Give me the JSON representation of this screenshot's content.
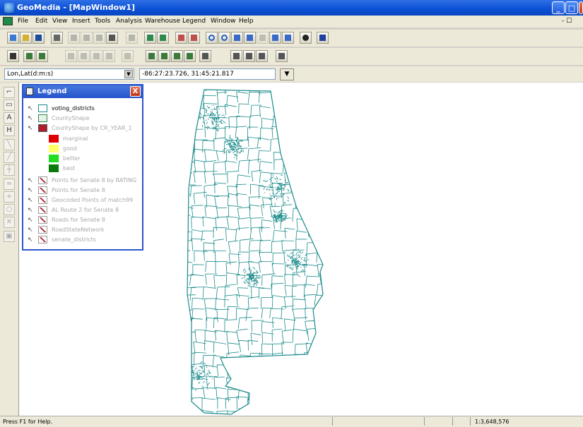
{
  "window": {
    "title": "GeoMedia - [MapWindow1]",
    "controls": [
      "_",
      "□",
      "X"
    ]
  },
  "menu": {
    "items": [
      "File",
      "Edit",
      "View",
      "Insert",
      "Tools",
      "Analysis",
      "Warehouse",
      "Legend",
      "Window",
      "Help"
    ],
    "mdi_controls": "- ☐"
  },
  "coords": {
    "system": "Lon,Lat(d:m:s)",
    "value": "-86:27:23.726, 31:45:21.817"
  },
  "legend": {
    "title": "Legend",
    "close": "X",
    "entries": [
      {
        "label": "voting_districts",
        "active": true
      },
      {
        "label": "CountyShape",
        "active": false
      },
      {
        "label": "CountyShape by CR_YEAR_1",
        "active": false
      },
      {
        "label": "Points for Senate 8 by RATING",
        "active": false
      },
      {
        "label": "Points for Senate 8",
        "active": false
      },
      {
        "label": "Geocoded Points of match99",
        "active": false
      },
      {
        "label": "AL Route 2 for Senate 8",
        "active": false
      },
      {
        "label": "Roads for Senate 8",
        "active": false
      },
      {
        "label": "RoadStateNetwork",
        "active": false
      },
      {
        "label": "senate_districts",
        "active": false
      }
    ],
    "classes": [
      {
        "label": "marginal",
        "color": "#e00000"
      },
      {
        "label": "good",
        "color": "#ffff66"
      },
      {
        "label": "better",
        "color": "#22dd22"
      },
      {
        "label": "best",
        "color": "#0a7a0a"
      }
    ]
  },
  "map": {
    "line_color": "#1b8a8a"
  },
  "status": {
    "message": "Press F1 for Help.",
    "scale": "1:3,648,576"
  }
}
